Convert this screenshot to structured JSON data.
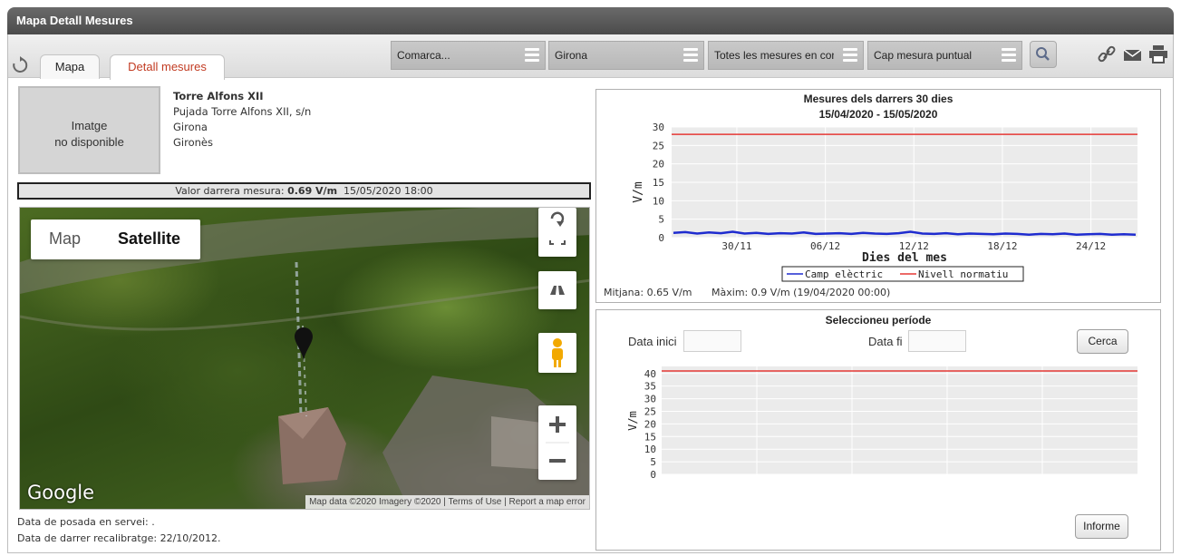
{
  "window": {
    "title": "Mapa Detall Mesures"
  },
  "tabs": [
    {
      "label": "Mapa"
    },
    {
      "label": "Detall mesures"
    }
  ],
  "filters": {
    "comarca": "Comarca...",
    "municipi": "Girona",
    "mesures": "Totes les mesures en cont",
    "puntual": "Cap mesura puntual"
  },
  "station": {
    "image_placeholder_line1": "Imatge",
    "image_placeholder_line2": "no disponible",
    "name": "Torre Alfons XII",
    "address": "Pujada Torre Alfons XII, s/n",
    "city": "Girona",
    "region": "Gironès"
  },
  "last_measure": {
    "label": "Valor darrera mesura:",
    "value": "0.69 V/m",
    "datetime": "15/05/2020 18:00"
  },
  "map": {
    "type_map": "Map",
    "type_satellite": "Satellite",
    "logo": "Google",
    "attribution": "Map data ©2020 Imagery ©2020",
    "terms": "Terms of Use",
    "report": "Report a map error"
  },
  "footer": {
    "service_date": "Data de posada en servei: .",
    "recalibration": "Data de darrer recalibratge: 22/10/2012."
  },
  "stats": {
    "mean": "Mitjana: 0.65 V/m",
    "max": "Màxim: 0.9 V/m (19/04/2020 00:00)"
  },
  "period": {
    "title": "Seleccioneu període",
    "start_label": "Data inici",
    "end_label": "Data fi",
    "search_button": "Cerca",
    "report_button": "Informe"
  },
  "colors": {
    "electric_field": "#1f2ccf",
    "normative": "#e53935",
    "plot_bg": "#ebebeb",
    "accent_tab": "#c23b22"
  },
  "chart_data": [
    {
      "type": "line",
      "title": "Mesures dels darrers 30 dies",
      "subtitle": "15/04/2020 - 15/05/2020",
      "xlabel": "Dies del mes",
      "ylabel": "V/m",
      "ylim": [
        0,
        30
      ],
      "yticks": [
        0,
        5,
        10,
        15,
        20,
        25,
        30
      ],
      "xticks": [
        "30/11",
        "06/12",
        "12/12",
        "18/12",
        "24/12"
      ],
      "legend_position": "bottom",
      "series": [
        {
          "name": "Camp elèctric",
          "values": [
            1.3,
            1.5,
            1.1,
            1.4,
            1.2,
            1.6,
            1.1,
            1.3,
            1.0,
            1.2,
            1.1,
            1.4,
            1.0,
            1.1,
            1.2,
            1.0,
            1.3,
            1.1,
            1.0,
            1.2,
            1.6,
            1.1,
            1.0,
            1.2,
            0.9,
            1.1,
            1.0,
            0.9,
            1.1,
            1.0,
            0.8,
            1.0,
            0.9,
            1.1,
            0.8,
            0.9,
            1.0,
            0.8,
            0.9,
            0.8
          ]
        },
        {
          "name": "Nivell normatiu",
          "values": [
            28,
            28
          ]
        }
      ]
    },
    {
      "type": "line",
      "ylabel": "V/m",
      "ylim": [
        0,
        40
      ],
      "yticks": [
        0,
        5,
        10,
        15,
        20,
        25,
        30,
        35,
        40
      ],
      "series": [
        {
          "values": [
            41,
            41
          ]
        }
      ]
    }
  ]
}
